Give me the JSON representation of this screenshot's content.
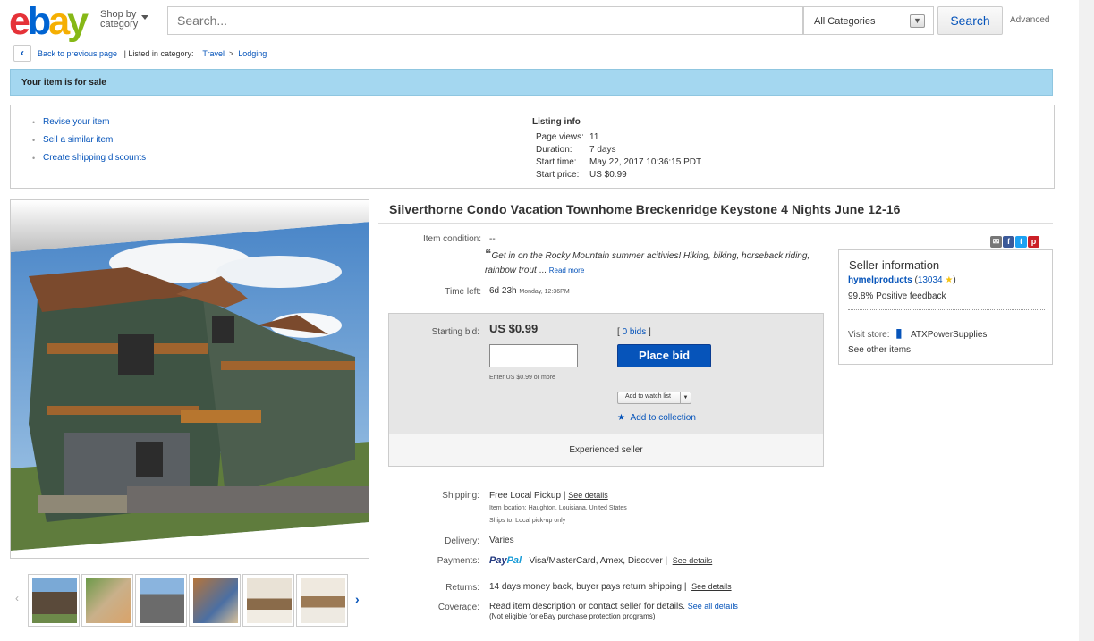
{
  "header": {
    "logo": {
      "e": "e",
      "b": "b",
      "a": "a",
      "y": "y"
    },
    "shop_by_line1": "Shop by",
    "shop_by_line2": "category",
    "search_placeholder": "Search...",
    "category_select": "All Categories",
    "search_button": "Search",
    "advanced_link": "Advanced"
  },
  "breadcrumb": {
    "back": "Back to previous page",
    "listed_in": "| Listed in category:",
    "cat1": "Travel",
    "sep": ">",
    "cat2": "Lodging"
  },
  "sale_bar": "Your item is for sale",
  "actions": [
    "Revise your item",
    "Sell a similar item",
    "Create shipping discounts"
  ],
  "listing_info": {
    "title": "Listing info",
    "rows": [
      {
        "k": "Page views:",
        "v": "11"
      },
      {
        "k": "Duration:",
        "v": "7 days"
      },
      {
        "k": "Start time:",
        "v": "May 22, 2017 10:36:15 PDT"
      },
      {
        "k": "Start price:",
        "v": "US $0.99"
      }
    ]
  },
  "item": {
    "title": "Silverthorne Condo Vacation Townhome Breckenridge Keystone 4 Nights June 12-16",
    "condition_label": "Item condition:",
    "condition_value": "--",
    "quote": "Get in on the Rocky Mountain summer acitivies! Hiking, biking, horseback riding, rainbow trout",
    "quote_ellipsis": "...",
    "read_more": "Read more",
    "time_left_label": "Time left:",
    "time_left_value": "6d 23h",
    "time_left_detail": "Monday, 12:36PM"
  },
  "bid": {
    "starting_label": "Starting bid:",
    "starting_value": "US $0.99",
    "bids_open": "[",
    "bids_link": "0 bids",
    "bids_close": "]",
    "input_hint": "Enter US $0.99 or more",
    "place_bid": "Place bid",
    "watch_list": "Add to watch list",
    "add_collection": "Add to collection",
    "experienced": "Experienced seller"
  },
  "seller": {
    "title": "Seller information",
    "name": "hymelproducts",
    "feedback_open": "(",
    "feedback_score": "13034",
    "feedback_close": ")",
    "positive": "99.8% Positive feedback",
    "visit_store": "Visit store:",
    "store_name": "ATXPowerSupplies",
    "other_items": "See other items"
  },
  "shipping": {
    "label": "Shipping:",
    "value": "Free Local Pickup |",
    "see_details": "See details",
    "location": "Item location:  Haughton, Louisiana, United States",
    "ships_to": "Ships to:  Local pick-up only"
  },
  "delivery": {
    "label": "Delivery:",
    "value": "Varies"
  },
  "payments": {
    "label": "Payments:",
    "paypal_1": "Pay",
    "paypal_2": "Pal",
    "value": "Visa/MasterCard, Amex, Discover  |",
    "see_details": "See details"
  },
  "returns": {
    "label": "Returns:",
    "value": "14 days money back, buyer pays return shipping  |",
    "see_details": "See details"
  },
  "coverage": {
    "label": "Coverage:",
    "value": "Read item description or contact seller for details.",
    "see_all": "See all details",
    "note": "(Not eligible for eBay purchase protection programs)"
  },
  "colors": {
    "accent": "#0654ba",
    "sale_bar": "#a4d7f0",
    "ebay_red": "#e53238",
    "ebay_blue": "#0064d2",
    "ebay_yellow": "#f5af02",
    "ebay_green": "#86b817"
  }
}
